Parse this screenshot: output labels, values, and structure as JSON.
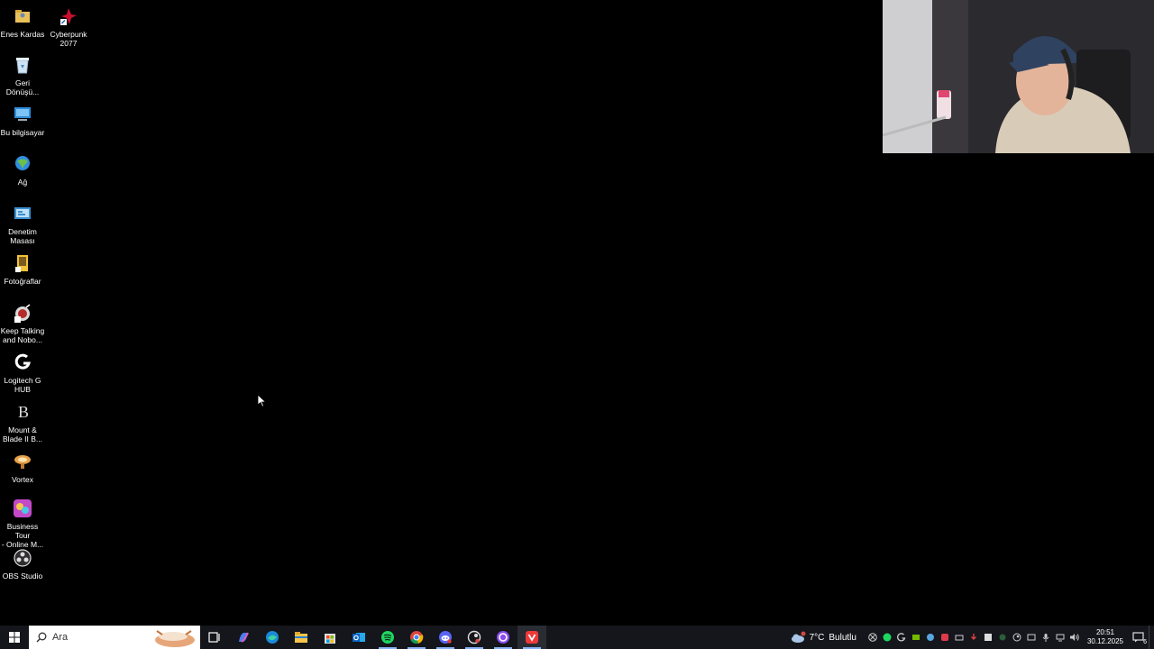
{
  "desktop": {
    "icons": [
      {
        "label": "Enes Kardas",
        "icon": "folder-user-icon"
      },
      {
        "label": "Cyberpunk\n2077",
        "icon": "cyberpunk-icon"
      },
      {
        "label": "Geri\nDönüşü...",
        "icon": "recycle-bin-icon"
      },
      {
        "label": "Bu bilgisayar",
        "icon": "computer-icon"
      },
      {
        "label": "Ağ",
        "icon": "network-icon"
      },
      {
        "label": "Denetim\nMasası",
        "icon": "control-panel-icon"
      },
      {
        "label": "Fotoğraflar",
        "icon": "photos-icon"
      },
      {
        "label": "Keep Talking\nand Nobo...",
        "icon": "keep-talking-icon"
      },
      {
        "label": "Logitech G\nHUB",
        "icon": "logitech-icon"
      },
      {
        "label": "Mount &\nBlade II B...",
        "icon": "bannerlord-icon"
      },
      {
        "label": "Vortex",
        "icon": "vortex-icon"
      },
      {
        "label": "Business Tour\n- Online M...",
        "icon": "business-tour-icon"
      },
      {
        "label": "OBS Studio",
        "icon": "obs-icon"
      }
    ]
  },
  "taskbar": {
    "search_placeholder": "Ara",
    "weather": {
      "temp": "7°C",
      "desc": "Bulutlu"
    },
    "clock": {
      "time": "20:51",
      "date": "30.12.2025"
    },
    "notification_count": "6",
    "apps": [
      "task-view-icon",
      "copilot-icon",
      "edge-icon",
      "file-explorer-icon",
      "store-icon",
      "outlook-icon",
      "spotify-icon",
      "chrome-icon",
      "discord-icon",
      "steam-like-icon",
      "circle-app-icon",
      "vivaldi-icon"
    ]
  },
  "colors": {
    "taskbar": "#14161b",
    "desktop": "#000000",
    "accent": "#8ab4f8"
  }
}
